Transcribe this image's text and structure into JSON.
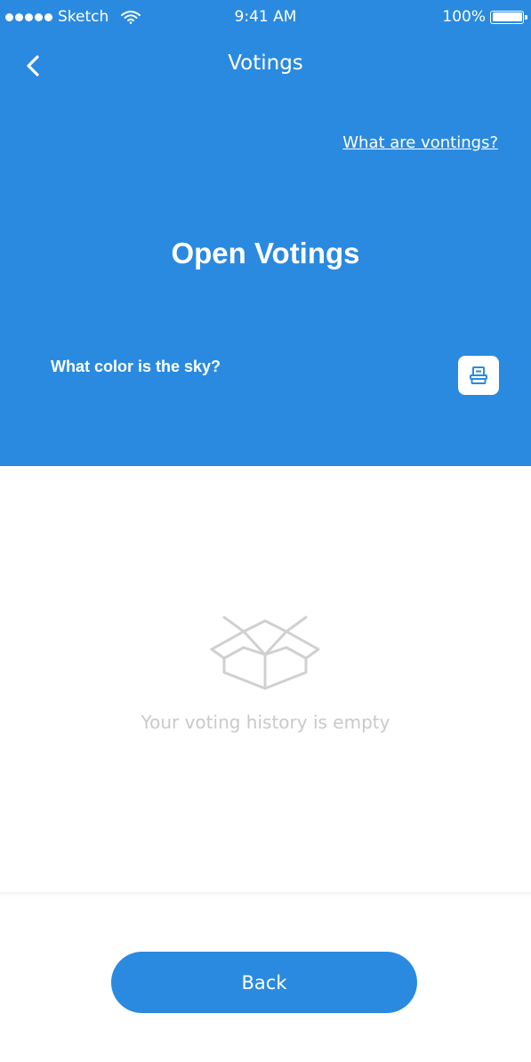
{
  "status_bar": {
    "carrier": "Sketch",
    "time": "9:41 AM",
    "battery": "100%"
  },
  "nav": {
    "title": "Votings",
    "back_icon": "chevron-left-icon"
  },
  "hero": {
    "help_link": "What are vontings?",
    "title": "Open Votings",
    "question": "What color is the sky?",
    "vote_icon": "ballot-box-icon"
  },
  "history": {
    "empty_icon": "open-box-icon",
    "empty_text": "Your voting history is empty"
  },
  "footer": {
    "back_label": "Back"
  },
  "colors": {
    "primary": "#2a8ae0",
    "muted_text": "#c9c9c9",
    "background": "#ffffff"
  }
}
